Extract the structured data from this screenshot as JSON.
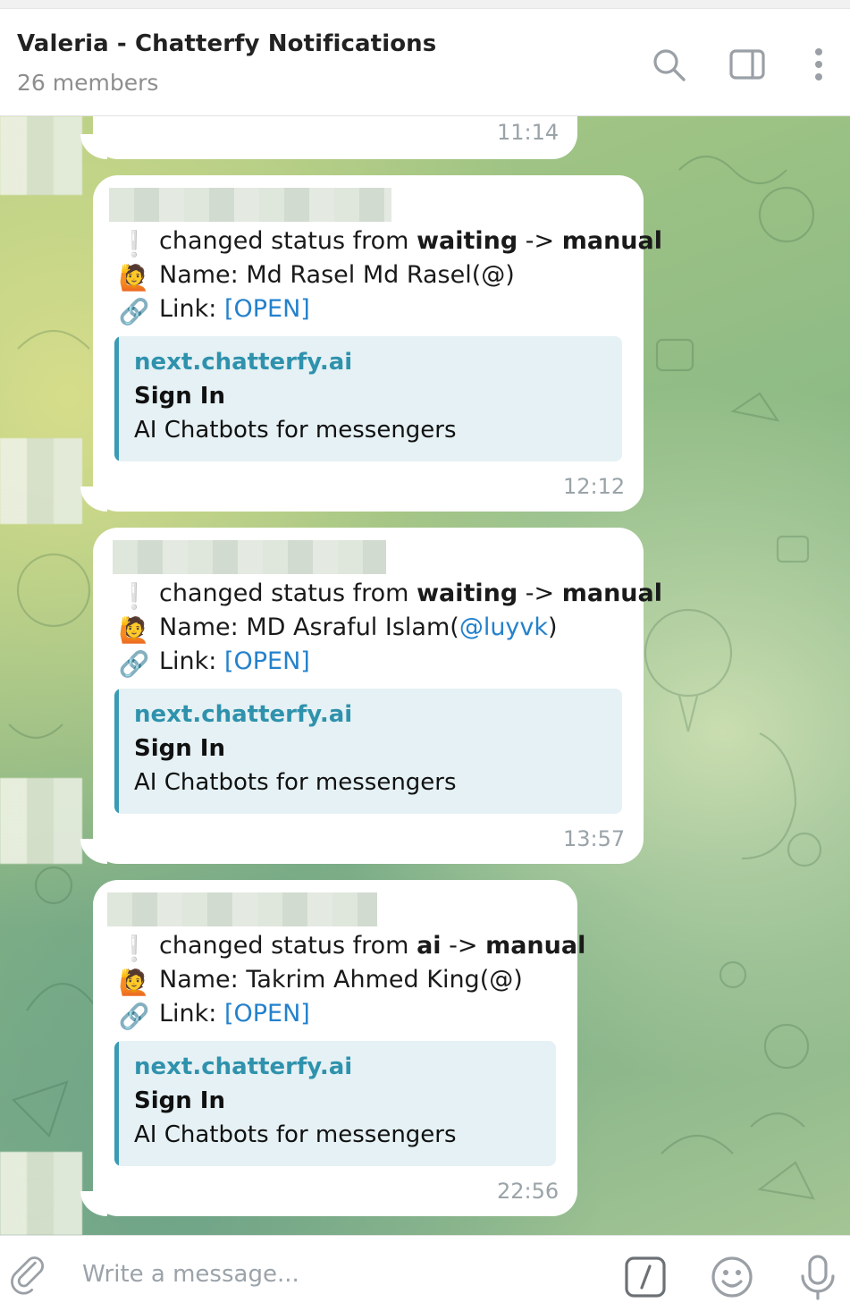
{
  "header": {
    "title": "Valeria - Chatterfy Notifications",
    "subtitle": "26 members",
    "icons": [
      "search-icon",
      "sidebar-toggle-icon",
      "more-vertical-icon"
    ]
  },
  "messages": [
    {
      "time": "11:14"
    },
    {
      "status_prefix": "changed status from ",
      "from": "waiting",
      "arrow": " -> ",
      "to": "manual",
      "name_label": "Name: Md Rasel Md Rasel(@)",
      "link_label": "Link: ",
      "link_text": "[OPEN]",
      "preview": {
        "site": "next.chatterfy.ai",
        "title": "Sign In",
        "description": "AI Chatbots for messengers"
      },
      "time": "12:12"
    },
    {
      "status_prefix": "changed status from ",
      "from": "waiting",
      "arrow": " -> ",
      "to": "manual",
      "name_prefix": "Name: MD Asraful Islam(",
      "name_handle": "@luyvk",
      "name_suffix": ")",
      "link_label": "Link: ",
      "link_text": "[OPEN]",
      "preview": {
        "site": "next.chatterfy.ai",
        "title": "Sign In",
        "description": "AI Chatbots for messengers"
      },
      "time": "13:57"
    },
    {
      "status_prefix": "changed status from ",
      "from": "ai",
      "arrow": " -> ",
      "to": "manual",
      "name_label": "Name: Takrim Ahmed King(@)",
      "link_label": "Link: ",
      "link_text": "[OPEN]",
      "preview": {
        "site": "next.chatterfy.ai",
        "title": "Sign In",
        "description": "AI Chatbots for messengers"
      },
      "time": "22:56"
    }
  ],
  "emojis": {
    "exclamation": "❕",
    "person": "🙋",
    "link": "🔗"
  },
  "composer": {
    "placeholder": "Write a message...",
    "icons": [
      "attach-icon",
      "bot-commands-icon",
      "emoji-icon",
      "microphone-icon"
    ]
  },
  "colors": {
    "link": "#2481cc",
    "preview_bar": "#3a9bb5",
    "preview_bg": "#e5f1f4"
  }
}
